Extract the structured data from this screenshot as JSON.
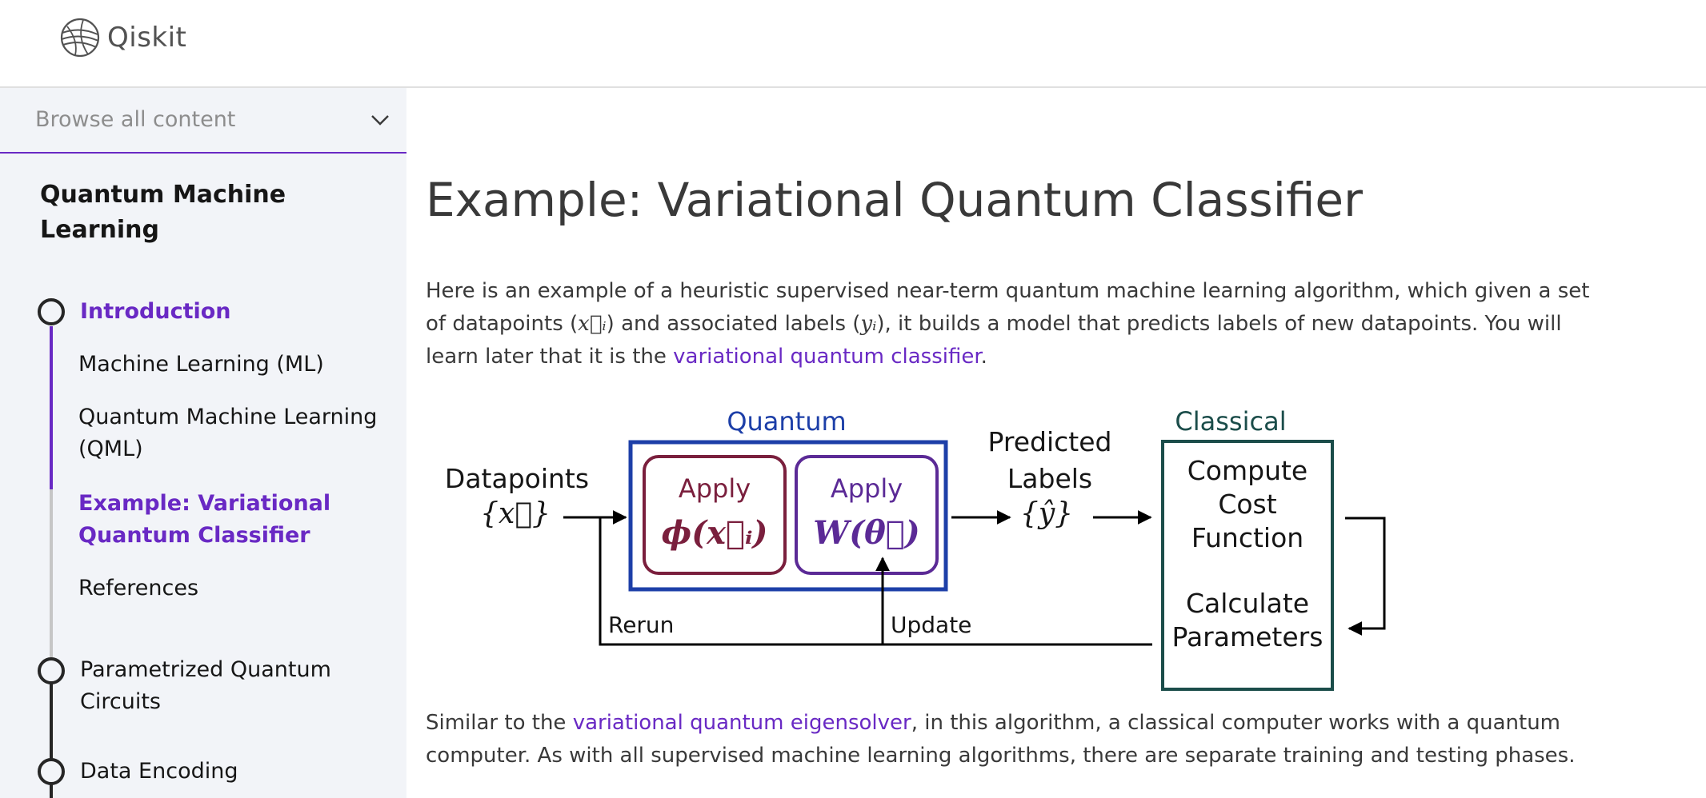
{
  "header": {
    "brand": "Qiskit",
    "logo_icon": "qiskit-logo-icon"
  },
  "sidebar": {
    "browse_label": "Browse all content",
    "course_title": "Quantum Machine Learning",
    "chapters": [
      {
        "label": "Introduction",
        "active": true,
        "sections": [
          {
            "label": "Machine Learning (ML)",
            "active": false
          },
          {
            "label": "Quantum Machine Learning (QML)",
            "active": false
          },
          {
            "label": "Example: Variational Quantum Classifier",
            "active": true
          },
          {
            "label": "References",
            "active": false
          }
        ]
      },
      {
        "label": "Parametrized Quantum Circuits",
        "active": false
      },
      {
        "label": "Data Encoding",
        "active": false
      }
    ],
    "accent_color": "#6929c4"
  },
  "main": {
    "title": "Example: Variational Quantum Classifier",
    "intro": {
      "text_1": "Here is an example of a heuristic supervised near-term quantum machine learning algorithm, which given a set of datapoints (",
      "math_1": "x⃗ᵢ",
      "text_2": ") and associated labels (",
      "math_2": "yᵢ",
      "text_3": "), it builds a model that predicts labels of new datapoints. You will learn later that it is the ",
      "link": "variational quantum classifier",
      "text_4": "."
    },
    "diagram": {
      "datapoints_label": "Datapoints",
      "datapoints_math": "{x⃗}",
      "quantum_label": "Quantum",
      "apply_1": "Apply",
      "phi_math": "ϕ(x⃗ᵢ)",
      "apply_2": "Apply",
      "w_math": "W(θ⃗)",
      "predicted_1": "Predicted",
      "predicted_2": "Labels",
      "yhat_math": "{ŷ}",
      "classical_label": "Classical",
      "compute_1": "Compute",
      "compute_2": "Cost",
      "compute_3": "Function",
      "calc_1": "Calculate",
      "calc_2": "Parameters",
      "rerun": "Rerun",
      "update": "Update",
      "colors": {
        "quantum": "#1d3fa8",
        "phi": "#7a1f3d",
        "w": "#5b2a96",
        "classical": "#1b4d4a"
      }
    },
    "outro": {
      "text_1": "Similar to the ",
      "link": "variational quantum eigensolver",
      "text_2": ", in this algorithm, a classical computer works with a quantum computer. As with all supervised machine learning algorithms, there are separate training and testing phases."
    }
  }
}
